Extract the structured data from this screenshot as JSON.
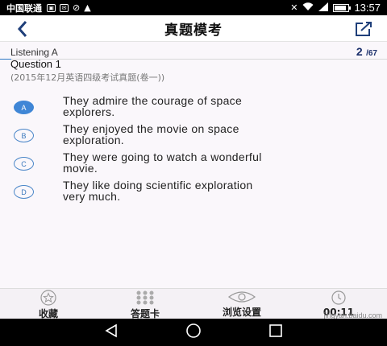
{
  "status_bar": {
    "carrier": "中国联通",
    "time": "13:57",
    "battery_level": 0.85
  },
  "header": {
    "title": "真题模考",
    "back_icon": "chevron-left-icon",
    "edit_icon": "edit-icon"
  },
  "question": {
    "section": "Listening A",
    "current": "2",
    "total": "/67",
    "progress": 0.03,
    "title": "Question 1",
    "source": "(2015年12月英语四级考试真题(卷一))"
  },
  "options": [
    {
      "letter": "A",
      "line1": "They admire the courage of space",
      "line2": "explorers.",
      "selected": true
    },
    {
      "letter": "B",
      "line1": "They enjoyed the movie on space",
      "line2": "exploration.",
      "selected": false
    },
    {
      "letter": "C",
      "line1": "They were going to watch a wonderful",
      "line2": "movie.",
      "selected": false
    },
    {
      "letter": "D",
      "line1": "They like doing scientific exploration",
      "line2": "very much.",
      "selected": false
    }
  ],
  "bottom_tabs": [
    {
      "label": "收藏",
      "icon": "star-icon"
    },
    {
      "label": "答题卡",
      "icon": "grid-icon"
    },
    {
      "label": "浏览设置",
      "icon": "eye-icon"
    },
    {
      "label": "00:11",
      "icon": "clock-icon"
    }
  ],
  "watermark": "jingyan.baidu.com",
  "colors": {
    "accent": "#3f86d6",
    "status_bar": "#000000",
    "text": "#222222"
  }
}
